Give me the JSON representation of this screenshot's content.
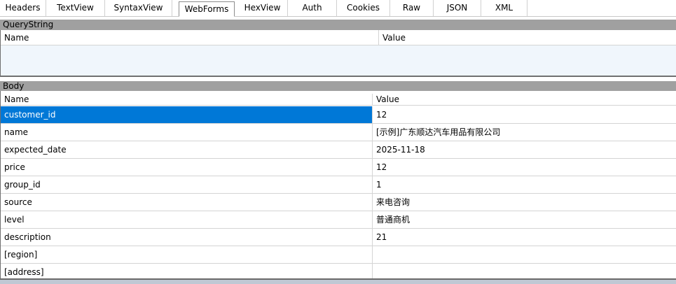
{
  "tabs": [
    {
      "label": "Headers",
      "active": false
    },
    {
      "label": "TextView",
      "active": false
    },
    {
      "label": "SyntaxView",
      "active": false
    },
    {
      "label": "WebForms",
      "active": true
    },
    {
      "label": "HexView",
      "active": false
    },
    {
      "label": "Auth",
      "active": false
    },
    {
      "label": "Cookies",
      "active": false
    },
    {
      "label": "Raw",
      "active": false
    },
    {
      "label": "JSON",
      "active": false
    },
    {
      "label": "XML",
      "active": false
    }
  ],
  "querystring": {
    "title": "QueryString",
    "columns": [
      "Name",
      "Value"
    ]
  },
  "body": {
    "title": "Body",
    "columns": [
      "Name",
      "Value"
    ],
    "rows": [
      {
        "name": "customer_id",
        "value": "12",
        "selected": true
      },
      {
        "name": "name",
        "value": "[示例]广东顺达汽车用品有限公司",
        "selected": false
      },
      {
        "name": "expected_date",
        "value": "2025-11-18",
        "selected": false
      },
      {
        "name": "price",
        "value": "12",
        "selected": false
      },
      {
        "name": "group_id",
        "value": "1",
        "selected": false
      },
      {
        "name": "source",
        "value": "来电咨询",
        "selected": false
      },
      {
        "name": "level",
        "value": "普通商机",
        "selected": false
      },
      {
        "name": "description",
        "value": "21",
        "selected": false
      },
      {
        "name": "[region]",
        "value": "",
        "selected": false
      },
      {
        "name": "[address]",
        "value": "",
        "selected": false
      }
    ]
  },
  "colors": {
    "selection": "#0078d7",
    "section_bar": "#a0a0a0",
    "querystring_bg": "#f0f6fc"
  }
}
